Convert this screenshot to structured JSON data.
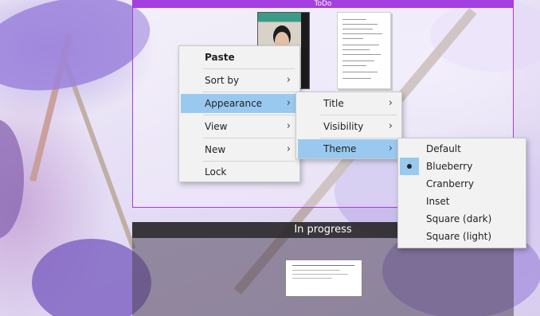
{
  "panels": {
    "todo": {
      "title": "ToDo"
    },
    "in_progress": {
      "title": "In progress"
    }
  },
  "context_menu": {
    "items": [
      {
        "label": "Paste"
      },
      {
        "label": "Sort by"
      },
      {
        "label": "Appearance"
      },
      {
        "label": "View"
      },
      {
        "label": "New"
      },
      {
        "label": "Lock"
      }
    ]
  },
  "appearance_submenu": {
    "items": [
      {
        "label": "Title"
      },
      {
        "label": "Visibility"
      },
      {
        "label": "Theme"
      }
    ]
  },
  "theme_submenu": {
    "selected": "Blueberry",
    "items": [
      {
        "label": "Default"
      },
      {
        "label": "Blueberry"
      },
      {
        "label": "Cranberry"
      },
      {
        "label": "Inset"
      },
      {
        "label": "Square (dark)"
      },
      {
        "label": "Square (light)"
      }
    ]
  },
  "colors": {
    "todo_header": "#a33fe0",
    "menu_highlight": "#99c9ef",
    "menu_background": "#f2f2f2"
  },
  "icons": {
    "submenu_arrow": "chevron-right-icon",
    "selected_marker": "radio-bullet-icon"
  }
}
